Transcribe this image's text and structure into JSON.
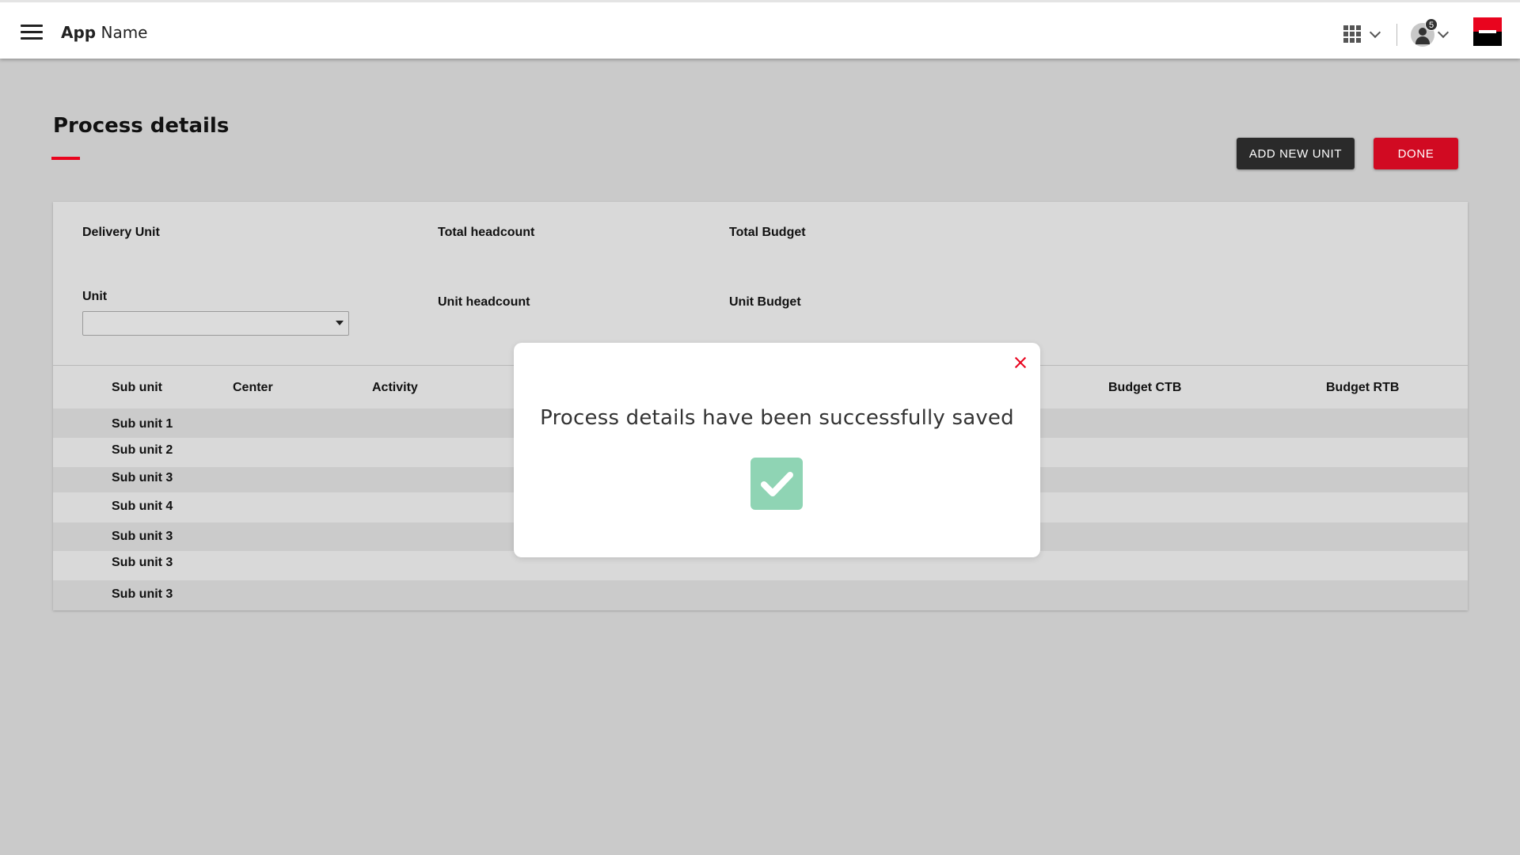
{
  "header": {
    "app_name_bold": "App",
    "app_name_rest": "Name",
    "notification_count": "5",
    "icons": {
      "menu": "hamburger-icon",
      "apps": "apps-grid-icon",
      "user": "user-avatar-icon",
      "brand": "brand-logo"
    }
  },
  "page": {
    "title": "Process details"
  },
  "actions": {
    "add_new_unit": "ADD NEW UNIT",
    "done": "DONE"
  },
  "summary": {
    "delivery_unit_label": "Delivery Unit",
    "total_headcount_label": "Total headcount",
    "total_budget_label": "Total Budget",
    "unit_label": "Unit",
    "unit_value": "",
    "unit_headcount_label": "Unit headcount",
    "unit_budget_label": "Unit Budget"
  },
  "table": {
    "columns": {
      "sub_unit": "Sub unit",
      "center": "Center",
      "activity": "Activity",
      "budget_ctb": "Budget CTB",
      "budget_rtb": "Budget RTB"
    },
    "rows": [
      "Sub unit 1",
      "Sub unit 2",
      "Sub unit 3",
      "Sub unit 4",
      "Sub unit 3",
      "Sub unit 3",
      "Sub unit 3"
    ]
  },
  "modal": {
    "message": "Process details have been successfully saved",
    "icon": "check-icon"
  },
  "colors": {
    "accent_red": "#e9041e",
    "done_button": "#d10a22",
    "add_button": "#2a2a2a",
    "success_green": "#8fd4b4",
    "overlay_bg": "#cacaca"
  }
}
